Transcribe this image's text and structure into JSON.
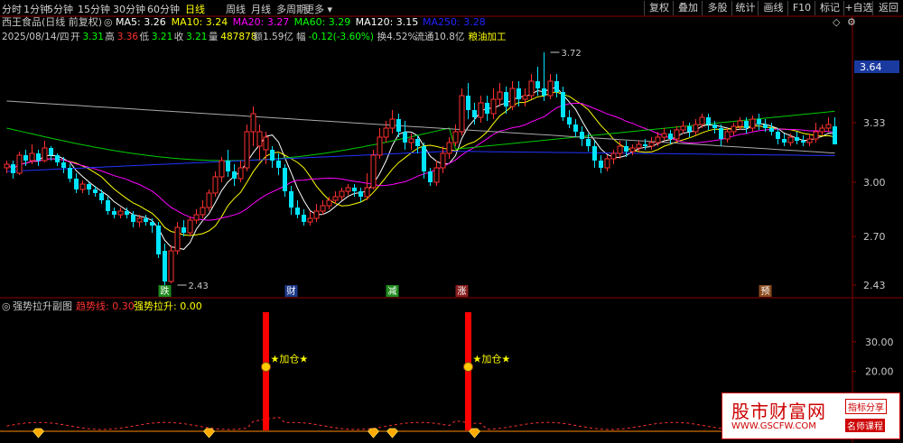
{
  "toolbar": {
    "periods": [
      "分时",
      "1分钟",
      "5分钟",
      "15分钟",
      "30分钟",
      "60分钟",
      "日线",
      "周线",
      "月线",
      "多周期",
      "更多"
    ],
    "active_period": "日线",
    "right_buttons": [
      "复权",
      "叠加",
      "多股",
      "统计",
      "画线",
      "F10",
      "标记",
      "+自选",
      "返回"
    ]
  },
  "stock": {
    "name": "西王食品(日线 前复权)",
    "ma_labels": [
      {
        "text": "MA5: 3.26",
        "color": "#ffffff"
      },
      {
        "text": "MA10: 3.24",
        "color": "#ffff00"
      },
      {
        "text": "MA20: 3.27",
        "color": "#ff00ff"
      },
      {
        "text": "MA60: 3.29",
        "color": "#00ff00"
      },
      {
        "text": "MA120: 3.15",
        "color": "#ffffff"
      },
      {
        "text": "MA250: 3.28",
        "color": "#2222ff"
      }
    ],
    "quote": [
      {
        "text": "2025/08/14/四",
        "color": "#c8c8c8"
      },
      {
        "text": "开",
        "color": "#c8c8c8"
      },
      {
        "text": "3.31",
        "color": "#00ff00"
      },
      {
        "text": "高",
        "color": "#c8c8c8"
      },
      {
        "text": "3.36",
        "color": "#ff3030"
      },
      {
        "text": "低",
        "color": "#c8c8c8"
      },
      {
        "text": "3.21",
        "color": "#00ff00"
      },
      {
        "text": "收",
        "color": "#c8c8c8"
      },
      {
        "text": "3.21",
        "color": "#00ff00"
      },
      {
        "text": "量",
        "color": "#c8c8c8"
      },
      {
        "text": "487878",
        "color": "#ffff00"
      },
      {
        "text": "额1.59亿",
        "color": "#c8c8c8"
      },
      {
        "text": "幅",
        "color": "#c8c8c8"
      },
      {
        "text": "-0.12(-3.60%)",
        "color": "#00ff00"
      },
      {
        "text": "换4.52%",
        "color": "#c8c8c8"
      },
      {
        "text": "流通10.8亿",
        "color": "#c8c8c8"
      },
      {
        "text": "粮油加工",
        "color": "#ffff00"
      }
    ]
  },
  "chart_data": [
    {
      "type": "candlestick",
      "y_axis_ticks": [
        3.33,
        3.0,
        2.7,
        2.43
      ],
      "ylim": [
        2.36,
        3.78
      ],
      "current_price_tag": 3.64,
      "annotations": [
        {
          "text": "3.72",
          "x": 86,
          "y": 3.72
        },
        {
          "text": "2.43",
          "x": 27,
          "y": 2.43
        }
      ],
      "event_markers": [
        {
          "text": "跌",
          "x": 25,
          "bg": "#1e8a1e"
        },
        {
          "text": "财",
          "x": 45,
          "bg": "#1e3a8a"
        },
        {
          "text": "减",
          "x": 61,
          "bg": "#1e8a1e"
        },
        {
          "text": "涨",
          "x": 72,
          "bg": "#8a1e1e"
        },
        {
          "text": "预",
          "x": 120,
          "bg": "#8a4a1e"
        }
      ],
      "candles": [
        [
          3.08,
          3.1,
          3.05,
          3.12
        ],
        [
          3.1,
          3.05,
          3.02,
          3.12
        ],
        [
          3.05,
          3.15,
          3.04,
          3.17
        ],
        [
          3.15,
          3.12,
          3.09,
          3.18
        ],
        [
          3.12,
          3.16,
          3.1,
          3.21
        ],
        [
          3.16,
          3.12,
          3.09,
          3.18
        ],
        [
          3.12,
          3.19,
          3.11,
          3.23
        ],
        [
          3.19,
          3.15,
          3.12,
          3.2
        ],
        [
          3.15,
          3.11,
          3.09,
          3.16
        ],
        [
          3.11,
          3.08,
          3.05,
          3.14
        ],
        [
          3.08,
          3.02,
          3.0,
          3.1
        ],
        [
          3.02,
          2.96,
          2.94,
          3.05
        ],
        [
          2.96,
          2.99,
          2.94,
          3.01
        ],
        [
          2.99,
          2.96,
          2.93,
          3.0
        ],
        [
          2.96,
          2.94,
          2.92,
          2.98
        ],
        [
          2.94,
          2.9,
          2.88,
          2.96
        ],
        [
          2.9,
          2.84,
          2.82,
          2.92
        ],
        [
          2.84,
          2.82,
          2.8,
          2.86
        ],
        [
          2.82,
          2.84,
          2.8,
          2.86
        ],
        [
          2.84,
          2.82,
          2.8,
          2.86
        ],
        [
          2.82,
          2.78,
          2.75,
          2.84
        ],
        [
          2.78,
          2.8,
          2.75,
          2.82
        ],
        [
          2.8,
          2.78,
          2.76,
          2.82
        ],
        [
          2.78,
          2.76,
          2.72,
          2.8
        ],
        [
          2.76,
          2.6,
          2.58,
          2.78
        ],
        [
          2.62,
          2.45,
          2.43,
          2.66
        ],
        [
          2.45,
          2.62,
          2.44,
          2.65
        ],
        [
          2.62,
          2.75,
          2.6,
          2.78
        ],
        [
          2.75,
          2.72,
          2.7,
          2.79
        ],
        [
          2.72,
          2.79,
          2.7,
          2.81
        ],
        [
          2.79,
          2.82,
          2.77,
          2.85
        ],
        [
          2.82,
          2.86,
          2.8,
          2.9
        ],
        [
          2.86,
          2.94,
          2.84,
          2.96
        ],
        [
          2.94,
          3.03,
          2.92,
          3.06
        ],
        [
          3.03,
          3.12,
          3.0,
          3.14
        ],
        [
          3.12,
          3.06,
          3.03,
          3.18
        ],
        [
          3.06,
          3.02,
          2.98,
          3.1
        ],
        [
          3.02,
          3.08,
          3.0,
          3.12
        ],
        [
          3.08,
          3.28,
          3.06,
          3.32
        ],
        [
          3.28,
          3.38,
          3.2,
          3.42
        ],
        [
          3.2,
          3.28,
          3.12,
          3.32
        ],
        [
          3.18,
          3.25,
          3.1,
          3.28
        ],
        [
          3.18,
          3.12,
          3.08,
          3.2
        ],
        [
          3.12,
          3.08,
          3.04,
          3.16
        ],
        [
          3.08,
          2.95,
          2.92,
          3.1
        ],
        [
          2.95,
          2.86,
          2.82,
          2.98
        ],
        [
          2.86,
          2.82,
          2.8,
          2.9
        ],
        [
          2.82,
          2.78,
          2.76,
          2.85
        ],
        [
          2.78,
          2.8,
          2.76,
          2.84
        ],
        [
          2.8,
          2.84,
          2.78,
          2.88
        ],
        [
          2.84,
          2.87,
          2.82,
          2.9
        ],
        [
          2.87,
          2.9,
          2.85,
          2.92
        ],
        [
          2.9,
          2.92,
          2.88,
          2.95
        ],
        [
          2.92,
          2.95,
          2.9,
          2.97
        ],
        [
          2.95,
          2.97,
          2.93,
          2.99
        ],
        [
          2.97,
          2.95,
          2.92,
          2.99
        ],
        [
          2.95,
          2.92,
          2.89,
          2.97
        ],
        [
          2.92,
          2.97,
          2.9,
          3.05
        ],
        [
          2.97,
          3.15,
          2.96,
          3.18
        ],
        [
          3.15,
          3.25,
          3.13,
          3.3
        ],
        [
          3.25,
          3.3,
          3.22,
          3.34
        ],
        [
          3.3,
          3.35,
          3.27,
          3.4
        ],
        [
          3.35,
          3.28,
          3.25,
          3.38
        ],
        [
          3.28,
          3.22,
          3.18,
          3.34
        ],
        [
          3.22,
          3.24,
          3.18,
          3.27
        ],
        [
          3.24,
          3.2,
          3.16,
          3.26
        ],
        [
          3.2,
          3.06,
          3.02,
          3.22
        ],
        [
          3.06,
          3.0,
          2.98,
          3.08
        ],
        [
          3.0,
          3.08,
          2.98,
          3.12
        ],
        [
          3.08,
          3.16,
          3.05,
          3.2
        ],
        [
          3.16,
          3.22,
          3.13,
          3.25
        ],
        [
          3.22,
          3.28,
          3.2,
          3.32
        ],
        [
          3.28,
          3.48,
          3.26,
          3.52
        ],
        [
          3.48,
          3.4,
          3.35,
          3.55
        ],
        [
          3.4,
          3.36,
          3.32,
          3.44
        ],
        [
          3.36,
          3.44,
          3.33,
          3.48
        ],
        [
          3.44,
          3.38,
          3.34,
          3.48
        ],
        [
          3.38,
          3.46,
          3.35,
          3.52
        ],
        [
          3.46,
          3.5,
          3.42,
          3.55
        ],
        [
          3.5,
          3.42,
          3.38,
          3.53
        ],
        [
          3.42,
          3.52,
          3.4,
          3.56
        ],
        [
          3.52,
          3.46,
          3.42,
          3.56
        ],
        [
          3.46,
          3.48,
          3.42,
          3.52
        ],
        [
          3.48,
          3.56,
          3.46,
          3.6
        ],
        [
          3.56,
          3.52,
          3.48,
          3.64
        ],
        [
          3.52,
          3.48,
          3.45,
          3.72
        ],
        [
          3.48,
          3.56,
          3.46,
          3.6
        ],
        [
          3.56,
          3.5,
          3.47,
          3.6
        ],
        [
          3.5,
          3.36,
          3.34,
          3.53
        ],
        [
          3.36,
          3.32,
          3.3,
          3.4
        ],
        [
          3.32,
          3.28,
          3.25,
          3.35
        ],
        [
          3.28,
          3.24,
          3.2,
          3.31
        ],
        [
          3.24,
          3.2,
          3.17,
          3.27
        ],
        [
          3.2,
          3.12,
          3.08,
          3.23
        ],
        [
          3.12,
          3.08,
          3.05,
          3.15
        ],
        [
          3.08,
          3.13,
          3.06,
          3.15
        ],
        [
          3.13,
          3.16,
          3.1,
          3.18
        ],
        [
          3.16,
          3.2,
          3.13,
          3.23
        ],
        [
          3.2,
          3.17,
          3.14,
          3.23
        ],
        [
          3.17,
          3.19,
          3.15,
          3.21
        ],
        [
          3.19,
          3.21,
          3.17,
          3.23
        ],
        [
          3.21,
          3.2,
          3.18,
          3.24
        ],
        [
          3.2,
          3.22,
          3.18,
          3.25
        ],
        [
          3.22,
          3.25,
          3.2,
          3.28
        ],
        [
          3.25,
          3.27,
          3.23,
          3.3
        ],
        [
          3.27,
          3.24,
          3.21,
          3.29
        ],
        [
          3.24,
          3.29,
          3.22,
          3.31
        ],
        [
          3.29,
          3.31,
          3.27,
          3.34
        ],
        [
          3.31,
          3.28,
          3.25,
          3.33
        ],
        [
          3.28,
          3.32,
          3.26,
          3.35
        ],
        [
          3.32,
          3.36,
          3.3,
          3.38
        ],
        [
          3.36,
          3.32,
          3.29,
          3.38
        ],
        [
          3.32,
          3.3,
          3.27,
          3.34
        ],
        [
          3.3,
          3.24,
          3.2,
          3.32
        ],
        [
          3.24,
          3.28,
          3.22,
          3.3
        ],
        [
          3.28,
          3.31,
          3.26,
          3.33
        ],
        [
          3.31,
          3.34,
          3.29,
          3.36
        ],
        [
          3.34,
          3.3,
          3.27,
          3.36
        ],
        [
          3.3,
          3.35,
          3.28,
          3.37
        ],
        [
          3.35,
          3.32,
          3.29,
          3.38
        ],
        [
          3.32,
          3.3,
          3.28,
          3.35
        ],
        [
          3.3,
          3.28,
          3.26,
          3.33
        ],
        [
          3.28,
          3.24,
          3.21,
          3.3
        ],
        [
          3.24,
          3.22,
          3.2,
          3.27
        ],
        [
          3.22,
          3.25,
          3.2,
          3.27
        ],
        [
          3.25,
          3.23,
          3.21,
          3.28
        ],
        [
          3.23,
          3.22,
          3.2,
          3.26
        ],
        [
          3.22,
          3.24,
          3.2,
          3.27
        ],
        [
          3.24,
          3.28,
          3.22,
          3.33
        ],
        [
          3.28,
          3.3,
          3.26,
          3.32
        ],
        [
          3.3,
          3.32,
          3.28,
          3.36
        ],
        [
          3.31,
          3.21,
          3.21,
          3.36
        ]
      ]
    },
    {
      "type": "indicator",
      "title": "强势拉升副图",
      "legend": [
        {
          "text": "趋势线: 0.30",
          "color": "#ff3030"
        },
        {
          "text": "强势拉升: 0.00",
          "color": "#ffff00"
        }
      ],
      "y_axis_ticks": [
        30.0,
        20.0
      ],
      "ylim": [
        0,
        40
      ],
      "spikes": [
        {
          "x": 41,
          "value": 40,
          "label": "★加仓★"
        },
        {
          "x": 73,
          "value": 40,
          "label": "★加仓★"
        }
      ],
      "diamond_markers_x": [
        5,
        32,
        58,
        61,
        74,
        114,
        127,
        153
      ]
    }
  ],
  "watermark": {
    "title": "股市财富网",
    "url": "WWW.GSCFW.COM",
    "tag1": "指标分享",
    "tag2": "名师课程"
  }
}
